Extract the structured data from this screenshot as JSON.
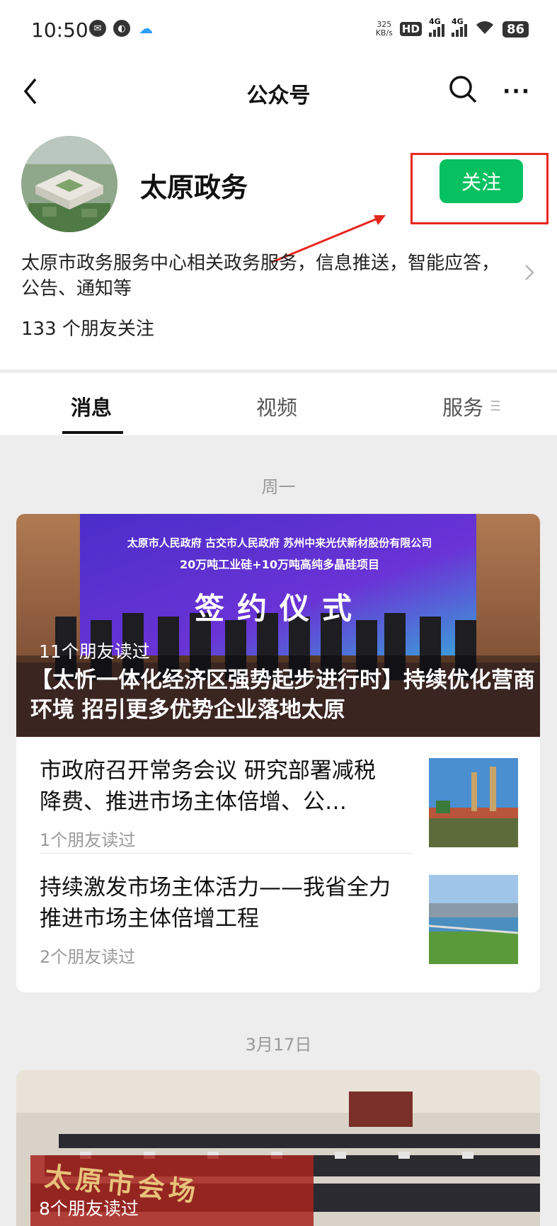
{
  "status_bar": {
    "time": "10:50",
    "speed_value": "325",
    "speed_unit": "KB/s",
    "hd_label": "HD",
    "net1": "4G",
    "net2": "4G",
    "battery": "86"
  },
  "nav": {
    "title": "公众号",
    "more_label": "···"
  },
  "account": {
    "name": "太原政务",
    "follow_label": "关注",
    "description": "太原市政务服务中心相关政务服务，信息推送，智能应答，公告、通知等",
    "friends_following": "133 个朋友关注"
  },
  "tabs": [
    {
      "label": "消息",
      "active": true
    },
    {
      "label": "视频",
      "active": false
    },
    {
      "label": "服务",
      "active": false
    }
  ],
  "feed": [
    {
      "date": "周一",
      "cover": {
        "banner_line1": "太原市人民政府 古交市人民政府 苏州中来光伏新材股份有限公司",
        "banner_line2": "20万吨工业硅+10万吨高纯多晶硅项目",
        "banner_line3": "签约仪式",
        "reads": "11个朋友读过",
        "title": "【太忻一体化经济区强势起步进行时】持续优化营商环境 招引更多优势企业落地太原"
      },
      "items": [
        {
          "title": "市政府召开常务会议 研究部署减税降费、推进市场主体倍增、公…",
          "reads": "1个朋友读过"
        },
        {
          "title": "持续激发市场主体活力——我省全力推进市场主体倍增工程",
          "reads": "2个朋友读过"
        }
      ]
    },
    {
      "date": "3月17日",
      "cover": {
        "banner_text": "太原市会场",
        "reads": "8个朋友读过"
      }
    }
  ],
  "colors": {
    "follow_green": "#07c160",
    "annotation_red": "#e8261e",
    "background": "#ededed"
  }
}
